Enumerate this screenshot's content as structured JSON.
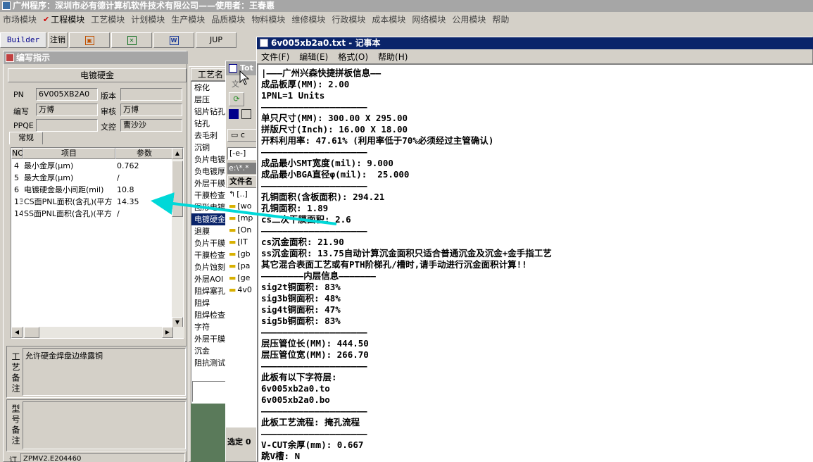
{
  "window": {
    "title": "广州程序：深圳市必有德计算机软件技术有限公司——使用者：王春惠"
  },
  "menu": {
    "items": [
      "市场模块",
      "工程模块",
      "工艺模块",
      "计划模块",
      "生产模块",
      "品质模块",
      "物料模块",
      "维修模块",
      "行政模块",
      "成本模块",
      "网络模块",
      "公用模块",
      "帮助"
    ],
    "active_index": 1
  },
  "toolbar": {
    "builder": "Builder",
    "logout": "注销",
    "jump": "JUP"
  },
  "left_panel": {
    "title": "编写指示",
    "header": "电镀硬金",
    "fields": {
      "pn_label": "PN",
      "pn_value": "6V005XB2A0",
      "version_label": "版本",
      "version_value": "",
      "author_label": "编写",
      "author_value": "万博",
      "review_label": "审核",
      "review_value": "万博",
      "ppqe_label": "PPQE",
      "ppqe_value": "",
      "control_label": "文控",
      "control_value": "曹沙沙"
    },
    "tab": "常规",
    "table": {
      "headers": [
        "NO",
        "项目",
        "参数"
      ],
      "rows": [
        {
          "no": "4",
          "item": "最小金厚(μm)",
          "param": "0.762"
        },
        {
          "no": "5",
          "item": "最大金厚(μm)",
          "param": "/"
        },
        {
          "no": "6",
          "item": "电镀硬金最小间距(mil)",
          "param": "10.8"
        },
        {
          "no": "13",
          "item": "CS面PNL面积(含孔)(平方",
          "param": "14.35"
        },
        {
          "no": "14",
          "item": "SS面PNL面积(含孔)(平方",
          "param": "/"
        }
      ]
    },
    "process_note_label": "工艺备注",
    "process_note": "允许硬金焊盘边缘露铜",
    "model_note_label": "型号备注",
    "model_note": "",
    "bottom_label": "订",
    "bottom_value": "ZPMV2.E204460"
  },
  "mid_panel": {
    "header": "工艺名",
    "items": [
      "棕化",
      "层压",
      "铝片钻孔",
      "钻孔",
      "去毛刺",
      "沉铜",
      "负片电镀",
      "负电镀厚",
      "外层干膜",
      "干膜检查",
      "图形电镀",
      "电镀硬金",
      "退膜",
      "负片干膜",
      "干膜检查",
      "负片蚀刻",
      "外层AOI",
      "阻焊塞孔",
      "阻焊",
      "阻焊检查",
      "字符",
      "外层干膜",
      "沉金",
      "阻抗测试"
    ],
    "selected_index": 11
  },
  "back_window": {
    "title": "Tot",
    "menu_text": "文",
    "drive": "c",
    "path_dropdown": "[-e-]",
    "path_text": "e:\\*.*",
    "column": "文件名",
    "files": [
      "[..]",
      "[wo",
      "[mp",
      "[On",
      "[IT",
      "[gb",
      "[pa",
      "[ge",
      "4v0"
    ],
    "status": "选定 0"
  },
  "notepad": {
    "title": "6v005xb2a0.txt - 记事本",
    "menu": [
      "文件(F)",
      "编辑(E)",
      "格式(O)",
      "帮助(H)"
    ],
    "lines": [
      "|———广州兴森快捷拼板信息——",
      "成品板厚(MM): 2.00",
      "1PNL=1 Units",
      "————————————————————",
      "单只尺寸(MM): 300.00 X 295.00",
      "拼版尺寸(Inch): 16.00 X 18.00",
      "开料利用率: 47.61% (利用率低于70%必须经过主管确认)",
      "————————————————————",
      "成品最小SMT宽度(mil): 9.000",
      "成品最小BGA直径φ(mil):  25.000",
      "————————————————————",
      "孔铜面积(含板面积): 294.21",
      "孔铜面积: 1.89",
      "cs二次干膜面积: 2.6",
      "————————————————————",
      "cs沉金面积: 21.90",
      "ss沉金面积: 13.75自动计算沉金面积只适合普通沉金及沉金+金手指工艺",
      "其它混合表面工艺或有PTH阶梯孔/槽时,请手动进行沉金面积计算!!",
      "————————内层信息———————",
      "sig2t铜面积: 83%",
      "sig3b铜面积: 48%",
      "sig4t铜面积: 47%",
      "sig5b铜面积: 83%",
      "————————————————————",
      "层压管位长(MM): 444.50",
      "层压管位宽(MM): 266.70",
      "————————————————————",
      "此板有以下字符层:",
      "6v005xb2a0.to",
      "6v005xb2a0.bo",
      "————————————————————",
      "此板工艺流程: 掩孔流程",
      "————————————————————",
      "V-CUT余厚(mm): 0.667",
      "跳V槽: N"
    ]
  },
  "colors": {
    "arrow": "#00d8d8",
    "titlebar_active": "#0a246a",
    "titlebar_inactive": "#a6a6a6",
    "selection": "#0a246a"
  }
}
